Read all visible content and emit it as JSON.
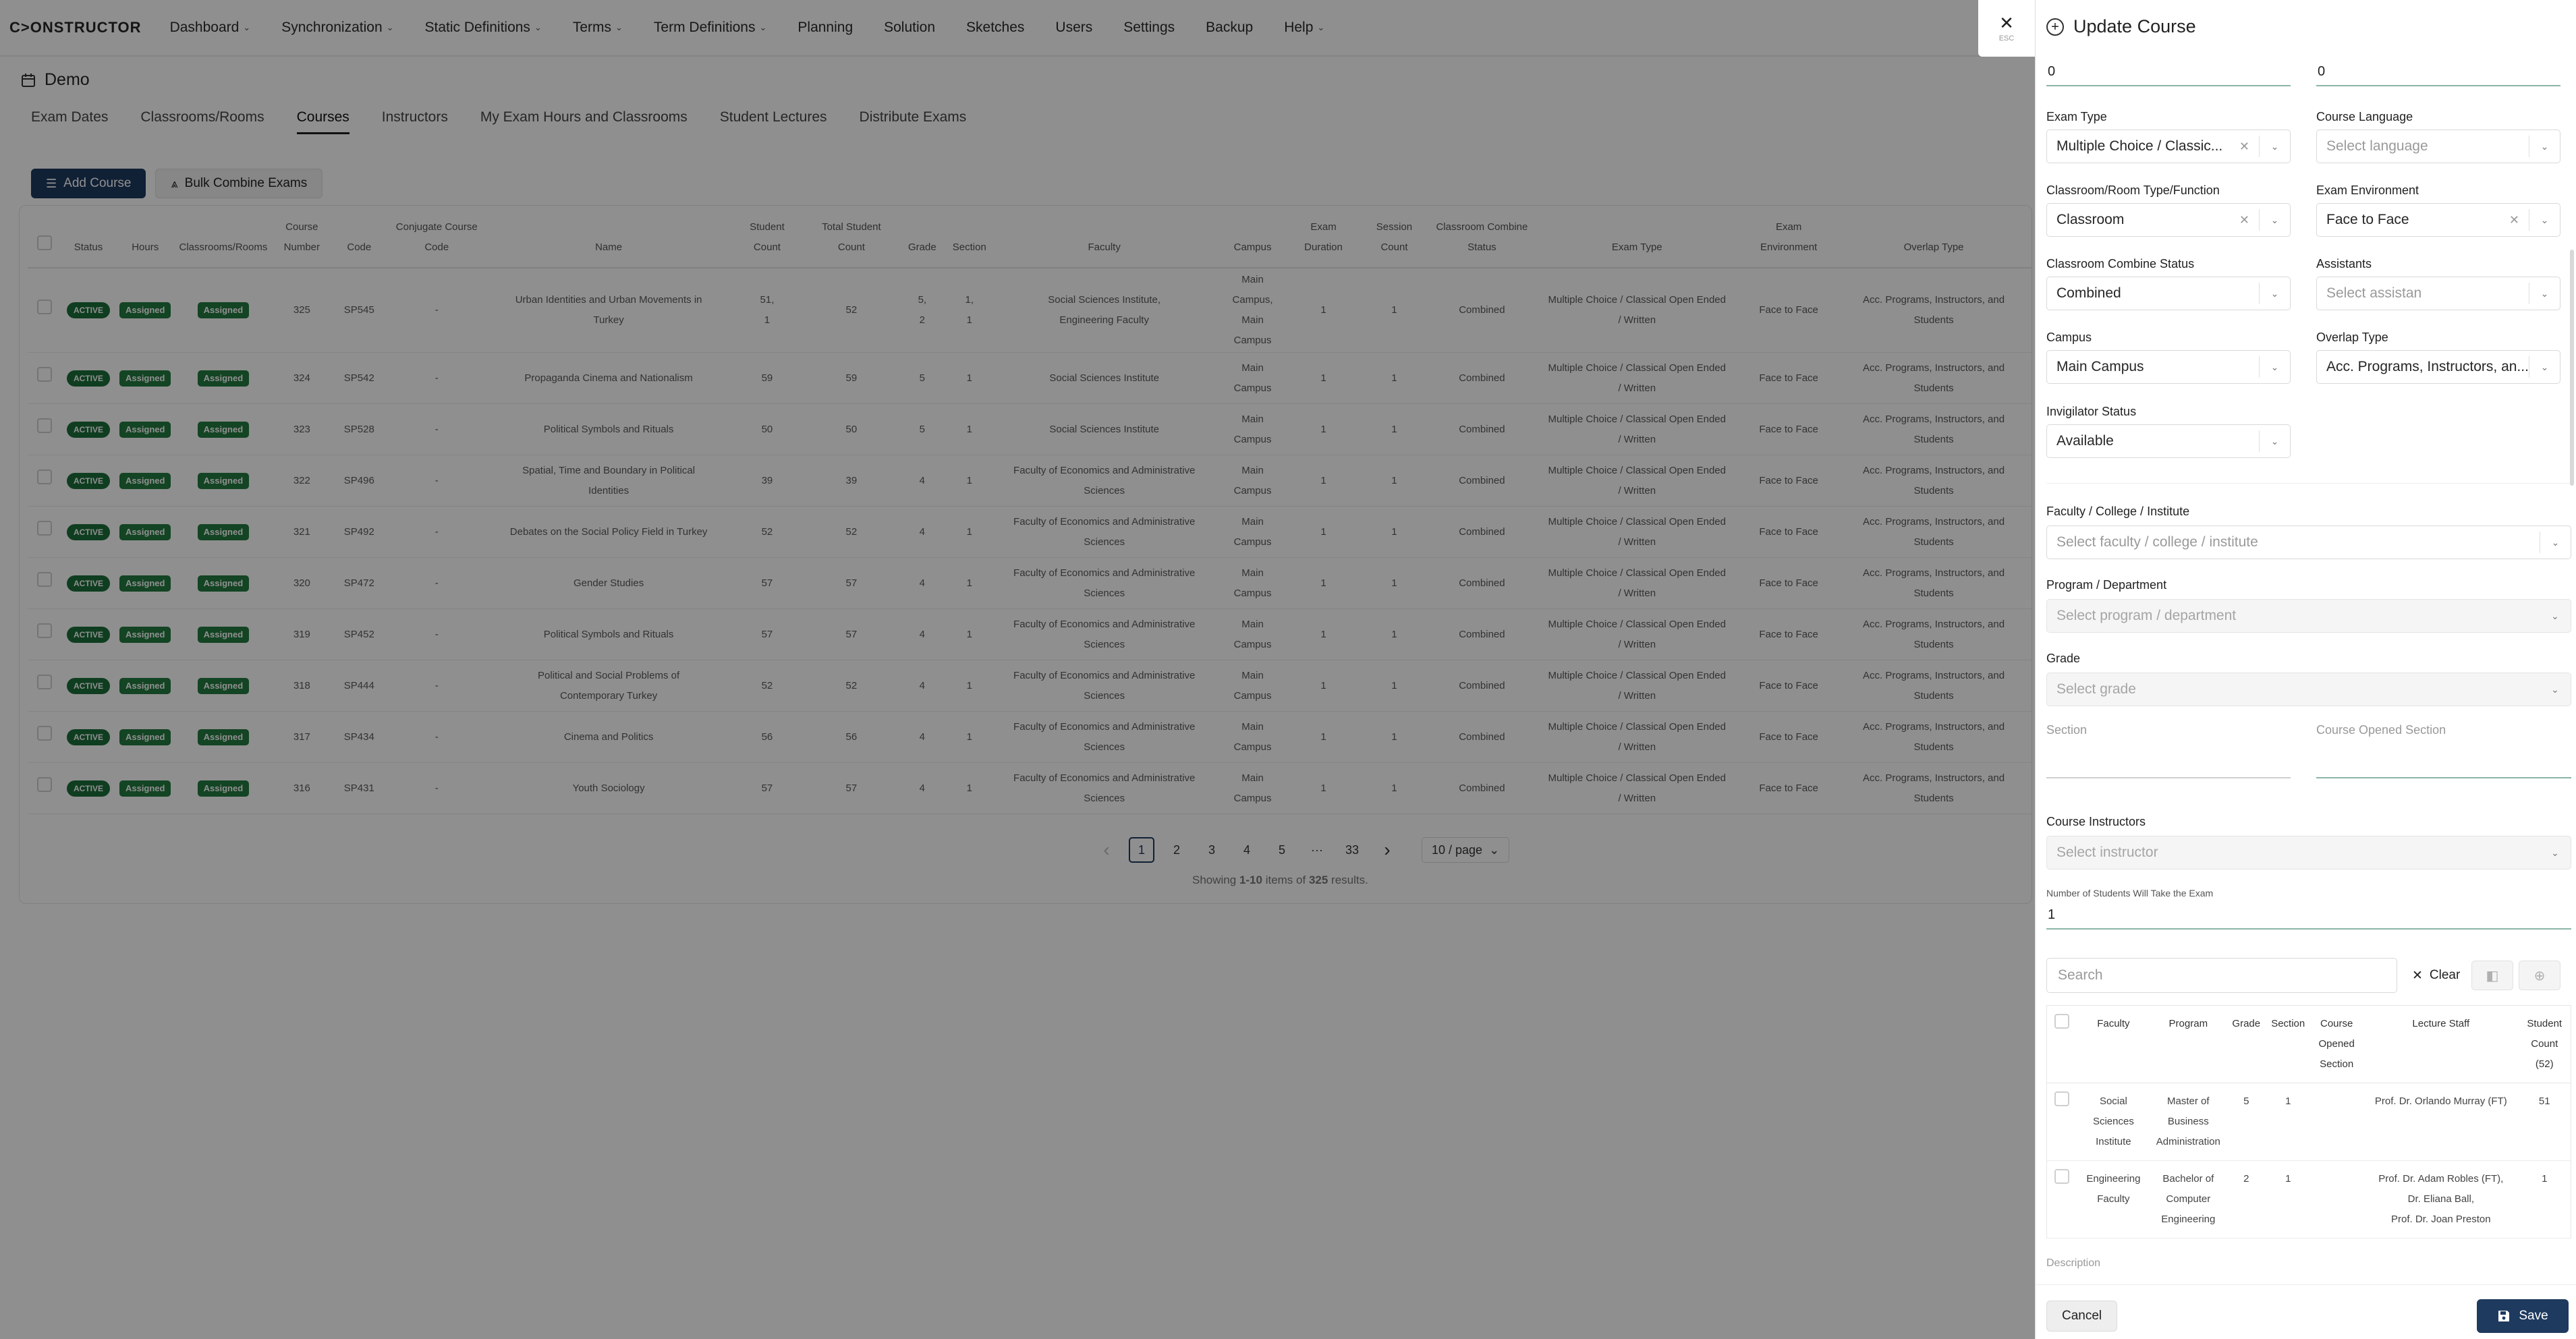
{
  "app": {
    "logo": "C>ONSTRUCTOR",
    "nav": [
      {
        "label": "Dashboard",
        "dropdown": true
      },
      {
        "label": "Synchronization",
        "dropdown": true
      },
      {
        "label": "Static Definitions",
        "dropdown": true
      },
      {
        "label": "Terms",
        "dropdown": true
      },
      {
        "label": "Term Definitions",
        "dropdown": true
      },
      {
        "label": "Planning",
        "dropdown": false
      },
      {
        "label": "Solution",
        "dropdown": false
      },
      {
        "label": "Sketches",
        "dropdown": false
      },
      {
        "label": "Users",
        "dropdown": false
      },
      {
        "label": "Settings",
        "dropdown": false
      },
      {
        "label": "Backup",
        "dropdown": false
      },
      {
        "label": "Help",
        "dropdown": true
      }
    ]
  },
  "page": {
    "title": "Demo",
    "tabs": [
      "Exam Dates",
      "Classrooms/Rooms",
      "Courses",
      "Instructors",
      "My Exam Hours and Classrooms",
      "Student Lectures",
      "Distribute Exams"
    ],
    "active_tab": "Courses",
    "add_course": "Add Course",
    "bulk_combine": "Bulk Combine Exams"
  },
  "table": {
    "headers": {
      "status": "Status",
      "hours": "Hours",
      "classrooms": "Classrooms/Rooms",
      "course_number_1": "Course",
      "course_number_2": "Number",
      "code": "Code",
      "conj_1": "Conjugate Course",
      "conj_2": "Code",
      "name": "Name",
      "student_count_1": "Student",
      "student_count_2": "Count",
      "total_1": "Total Student",
      "total_2": "Count",
      "grade": "Grade",
      "section": "Section",
      "faculty": "Faculty",
      "campus": "Campus",
      "exam_duration_1": "Exam",
      "exam_duration_2": "Duration",
      "session_1": "Session",
      "session_2": "Count",
      "combine_1": "Classroom Combine",
      "combine_2": "Status",
      "exam_type": "Exam Type",
      "env_1": "Exam",
      "env_2": "Environment",
      "overlap": "Overlap Type"
    },
    "rows": [
      {
        "status": "ACTIVE",
        "hours": "Assigned",
        "classrooms": "Assigned",
        "number": "325",
        "code": "SP545",
        "conj": "-",
        "name": [
          "Urban Identities and Urban Movements in",
          "Turkey"
        ],
        "student_count": [
          "51,",
          "1"
        ],
        "total": "52",
        "grade": [
          "5,",
          "2"
        ],
        "section": [
          "1,",
          "1"
        ],
        "faculty": [
          "Social Sciences Institute,",
          "Engineering Faculty"
        ],
        "campus": [
          "Main",
          "Campus,",
          "Main",
          "Campus"
        ],
        "duration": "1",
        "session": "1",
        "combine": "Combined",
        "exam_type": [
          "Multiple Choice / Classical Open Ended",
          "/ Written"
        ],
        "env": "Face to Face",
        "overlap": [
          "Acc. Programs, Instructors, and",
          "Students"
        ]
      },
      {
        "status": "ACTIVE",
        "hours": "Assigned",
        "classrooms": "Assigned",
        "number": "324",
        "code": "SP542",
        "conj": "-",
        "name": [
          "Propaganda Cinema and Nationalism"
        ],
        "student_count": [
          "59"
        ],
        "total": "59",
        "grade": [
          "5"
        ],
        "section": [
          "1"
        ],
        "faculty": [
          "Social Sciences Institute"
        ],
        "campus": [
          "Main",
          "Campus"
        ],
        "duration": "1",
        "session": "1",
        "combine": "Combined",
        "exam_type": [
          "Multiple Choice / Classical Open Ended",
          "/ Written"
        ],
        "env": "Face to Face",
        "overlap": [
          "Acc. Programs, Instructors, and",
          "Students"
        ]
      },
      {
        "status": "ACTIVE",
        "hours": "Assigned",
        "classrooms": "Assigned",
        "number": "323",
        "code": "SP528",
        "conj": "-",
        "name": [
          "Political Symbols and Rituals"
        ],
        "student_count": [
          "50"
        ],
        "total": "50",
        "grade": [
          "5"
        ],
        "section": [
          "1"
        ],
        "faculty": [
          "Social Sciences Institute"
        ],
        "campus": [
          "Main",
          "Campus"
        ],
        "duration": "1",
        "session": "1",
        "combine": "Combined",
        "exam_type": [
          "Multiple Choice / Classical Open Ended",
          "/ Written"
        ],
        "env": "Face to Face",
        "overlap": [
          "Acc. Programs, Instructors, and",
          "Students"
        ]
      },
      {
        "status": "ACTIVE",
        "hours": "Assigned",
        "classrooms": "Assigned",
        "number": "322",
        "code": "SP496",
        "conj": "-",
        "name": [
          "Spatial, Time and Boundary in Political",
          "Identities"
        ],
        "student_count": [
          "39"
        ],
        "total": "39",
        "grade": [
          "4"
        ],
        "section": [
          "1"
        ],
        "faculty": [
          "Faculty of Economics and Administrative",
          "Sciences"
        ],
        "campus": [
          "Main",
          "Campus"
        ],
        "duration": "1",
        "session": "1",
        "combine": "Combined",
        "exam_type": [
          "Multiple Choice / Classical Open Ended",
          "/ Written"
        ],
        "env": "Face to Face",
        "overlap": [
          "Acc. Programs, Instructors, and",
          "Students"
        ]
      },
      {
        "status": "ACTIVE",
        "hours": "Assigned",
        "classrooms": "Assigned",
        "number": "321",
        "code": "SP492",
        "conj": "-",
        "name": [
          "Debates on the Social Policy Field in Turkey"
        ],
        "student_count": [
          "52"
        ],
        "total": "52",
        "grade": [
          "4"
        ],
        "section": [
          "1"
        ],
        "faculty": [
          "Faculty of Economics and Administrative",
          "Sciences"
        ],
        "campus": [
          "Main",
          "Campus"
        ],
        "duration": "1",
        "session": "1",
        "combine": "Combined",
        "exam_type": [
          "Multiple Choice / Classical Open Ended",
          "/ Written"
        ],
        "env": "Face to Face",
        "overlap": [
          "Acc. Programs, Instructors, and",
          "Students"
        ]
      },
      {
        "status": "ACTIVE",
        "hours": "Assigned",
        "classrooms": "Assigned",
        "number": "320",
        "code": "SP472",
        "conj": "-",
        "name": [
          "Gender Studies"
        ],
        "student_count": [
          "57"
        ],
        "total": "57",
        "grade": [
          "4"
        ],
        "section": [
          "1"
        ],
        "faculty": [
          "Faculty of Economics and Administrative",
          "Sciences"
        ],
        "campus": [
          "Main",
          "Campus"
        ],
        "duration": "1",
        "session": "1",
        "combine": "Combined",
        "exam_type": [
          "Multiple Choice / Classical Open Ended",
          "/ Written"
        ],
        "env": "Face to Face",
        "overlap": [
          "Acc. Programs, Instructors, and",
          "Students"
        ]
      },
      {
        "status": "ACTIVE",
        "hours": "Assigned",
        "classrooms": "Assigned",
        "number": "319",
        "code": "SP452",
        "conj": "-",
        "name": [
          "Political Symbols and Rituals"
        ],
        "student_count": [
          "57"
        ],
        "total": "57",
        "grade": [
          "4"
        ],
        "section": [
          "1"
        ],
        "faculty": [
          "Faculty of Economics and Administrative",
          "Sciences"
        ],
        "campus": [
          "Main",
          "Campus"
        ],
        "duration": "1",
        "session": "1",
        "combine": "Combined",
        "exam_type": [
          "Multiple Choice / Classical Open Ended",
          "/ Written"
        ],
        "env": "Face to Face",
        "overlap": [
          "Acc. Programs, Instructors, and",
          "Students"
        ]
      },
      {
        "status": "ACTIVE",
        "hours": "Assigned",
        "classrooms": "Assigned",
        "number": "318",
        "code": "SP444",
        "conj": "-",
        "name": [
          "Political and Social Problems of",
          "Contemporary Turkey"
        ],
        "student_count": [
          "52"
        ],
        "total": "52",
        "grade": [
          "4"
        ],
        "section": [
          "1"
        ],
        "faculty": [
          "Faculty of Economics and Administrative",
          "Sciences"
        ],
        "campus": [
          "Main",
          "Campus"
        ],
        "duration": "1",
        "session": "1",
        "combine": "Combined",
        "exam_type": [
          "Multiple Choice / Classical Open Ended",
          "/ Written"
        ],
        "env": "Face to Face",
        "overlap": [
          "Acc. Programs, Instructors, and",
          "Students"
        ]
      },
      {
        "status": "ACTIVE",
        "hours": "Assigned",
        "classrooms": "Assigned",
        "number": "317",
        "code": "SP434",
        "conj": "-",
        "name": [
          "Cinema and Politics"
        ],
        "student_count": [
          "56"
        ],
        "total": "56",
        "grade": [
          "4"
        ],
        "section": [
          "1"
        ],
        "faculty": [
          "Faculty of Economics and Administrative",
          "Sciences"
        ],
        "campus": [
          "Main",
          "Campus"
        ],
        "duration": "1",
        "session": "1",
        "combine": "Combined",
        "exam_type": [
          "Multiple Choice / Classical Open Ended",
          "/ Written"
        ],
        "env": "Face to Face",
        "overlap": [
          "Acc. Programs, Instructors, and",
          "Students"
        ]
      },
      {
        "status": "ACTIVE",
        "hours": "Assigned",
        "classrooms": "Assigned",
        "number": "316",
        "code": "SP431",
        "conj": "-",
        "name": [
          "Youth Sociology"
        ],
        "student_count": [
          "57"
        ],
        "total": "57",
        "grade": [
          "4"
        ],
        "section": [
          "1"
        ],
        "faculty": [
          "Faculty of Economics and Administrative",
          "Sciences"
        ],
        "campus": [
          "Main",
          "Campus"
        ],
        "duration": "1",
        "session": "1",
        "combine": "Combined",
        "exam_type": [
          "Multiple Choice / Classical Open Ended",
          "/ Written"
        ],
        "env": "Face to Face",
        "overlap": [
          "Acc. Programs, Instructors, and",
          "Students"
        ]
      }
    ]
  },
  "pagination": {
    "pages": [
      "1",
      "2",
      "3",
      "4",
      "5",
      "···",
      "33"
    ],
    "current": "1",
    "page_size": "10 / page",
    "results_prefix": "Showing ",
    "results_range": "1-10",
    "results_mid": " items of ",
    "results_total": "325",
    "results_suffix": " results."
  },
  "modal": {
    "close_label": "ESC",
    "title": "Update Course",
    "top_left_value": "0",
    "top_right_value": "0",
    "exam_type_label": "Exam Type",
    "exam_type_value": "Multiple Choice / Classic...",
    "course_language_label": "Course Language",
    "course_language_placeholder": "Select language",
    "room_type_label": "Classroom/Room Type/Function",
    "room_type_value": "Classroom",
    "exam_env_label": "Exam Environment",
    "exam_env_value": "Face to Face",
    "combine_status_label": "Classroom Combine Status",
    "combine_status_value": "Combined",
    "assistants_label": "Assistants",
    "assistants_placeholder": "Select assistan",
    "campus_label": "Campus",
    "campus_value": "Main Campus",
    "overlap_label": "Overlap Type",
    "overlap_value": "Acc. Programs, Instructors, an...",
    "invigilator_label": "Invigilator Status",
    "invigilator_value": "Available",
    "faculty_label": "Faculty / College / Institute",
    "faculty_placeholder": "Select faculty / college / institute",
    "program_label": "Program / Department",
    "program_placeholder": "Select program / department",
    "grade_label": "Grade",
    "grade_placeholder": "Select grade",
    "section_label": "Section",
    "course_opened_section_label": "Course Opened Section",
    "instructors_label": "Course Instructors",
    "instructors_placeholder": "Select instructor",
    "num_students_label": "Number of Students Will Take the Exam",
    "num_students_value": "1",
    "search_placeholder": "Search",
    "clear_label": "Clear",
    "inner_headers": {
      "faculty": "Faculty",
      "program": "Program",
      "grade": "Grade",
      "section": "Section",
      "opened": [
        "Course",
        "Opened",
        "Section"
      ],
      "staff": "Lecture Staff",
      "count": [
        "Student",
        "Count",
        "(52)"
      ]
    },
    "inner_rows": [
      {
        "faculty": [
          "Social Sciences",
          "Institute"
        ],
        "program": [
          "Master of",
          "Business",
          "Administration"
        ],
        "grade": "5",
        "section": "1",
        "opened": "",
        "staff": [
          "Prof. Dr. Orlando Murray (FT)"
        ],
        "count": "51"
      },
      {
        "faculty": [
          "Engineering",
          "Faculty"
        ],
        "program": [
          "Bachelor of",
          "Computer",
          "Engineering"
        ],
        "grade": "2",
        "section": "1",
        "opened": "",
        "staff": [
          "Prof. Dr. Adam Robles (FT),",
          "Dr. Eliana Ball,",
          "Prof. Dr. Joan Preston"
        ],
        "count": "1"
      }
    ],
    "description_label": "Description",
    "cancel_label": "Cancel",
    "save_label": "Save"
  }
}
